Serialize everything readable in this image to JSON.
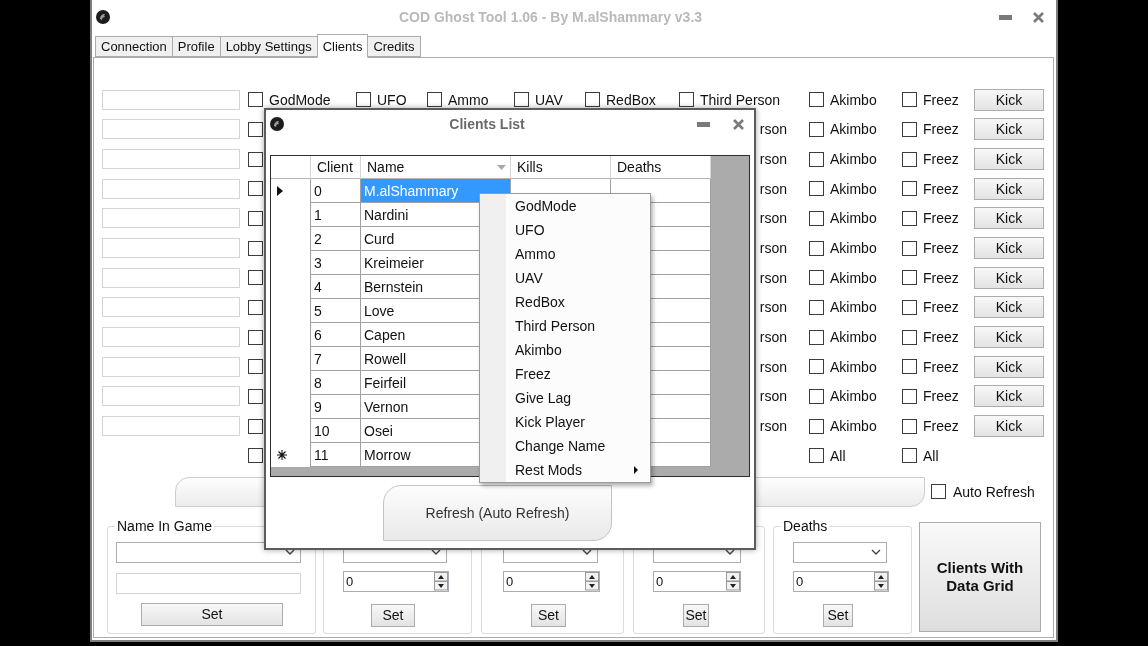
{
  "window": {
    "title": "COD Ghost Tool 1.06 - By M.alShammary v3.3"
  },
  "tabs": [
    {
      "label": "Connection",
      "selected": false
    },
    {
      "label": "Profile",
      "selected": false
    },
    {
      "label": "Lobby Settings",
      "selected": false
    },
    {
      "label": "Clients",
      "selected": true
    },
    {
      "label": "Credits",
      "selected": false
    }
  ],
  "client_rows": [
    {
      "kind": "client",
      "mods": [
        {
          "kind": "check",
          "label": "GodMode",
          "checked": false
        },
        {
          "kind": "check",
          "label": "UFO",
          "checked": false
        },
        {
          "kind": "check",
          "label": "Ammo",
          "checked": false
        },
        {
          "kind": "check",
          "label": "UAV",
          "checked": false
        },
        {
          "kind": "check",
          "label": "RedBox",
          "checked": false
        },
        {
          "kind": "check",
          "label": "Third Person",
          "checked": false
        },
        {
          "kind": "check",
          "label": "Akimbo",
          "checked": false
        },
        {
          "kind": "check",
          "label": "Freez",
          "checked": false
        }
      ],
      "button": "Kick"
    },
    {
      "kind": "client",
      "mods": [
        {
          "kind": "box",
          "checked": false
        },
        {
          "kind": "text",
          "label": "rson"
        },
        {
          "kind": "check",
          "label": "Akimbo",
          "checked": false
        },
        {
          "kind": "check",
          "label": "Freez",
          "checked": false
        }
      ],
      "button": "Kick"
    },
    {
      "kind": "client",
      "mods": [
        {
          "kind": "box",
          "checked": false
        },
        {
          "kind": "text",
          "label": "rson"
        },
        {
          "kind": "check",
          "label": "Akimbo",
          "checked": false
        },
        {
          "kind": "check",
          "label": "Freez",
          "checked": false
        }
      ],
      "button": "Kick"
    },
    {
      "kind": "client",
      "mods": [
        {
          "kind": "box",
          "checked": false
        },
        {
          "kind": "text",
          "label": "rson"
        },
        {
          "kind": "check",
          "label": "Akimbo",
          "checked": false
        },
        {
          "kind": "check",
          "label": "Freez",
          "checked": false
        }
      ],
      "button": "Kick"
    },
    {
      "kind": "client",
      "mods": [
        {
          "kind": "box",
          "checked": false
        },
        {
          "kind": "text",
          "label": "rson"
        },
        {
          "kind": "check",
          "label": "Akimbo",
          "checked": false
        },
        {
          "kind": "check",
          "label": "Freez",
          "checked": false
        }
      ],
      "button": "Kick"
    },
    {
      "kind": "client",
      "mods": [
        {
          "kind": "box",
          "checked": false
        },
        {
          "kind": "text",
          "label": "rson"
        },
        {
          "kind": "check",
          "label": "Akimbo",
          "checked": false
        },
        {
          "kind": "check",
          "label": "Freez",
          "checked": false
        }
      ],
      "button": "Kick"
    },
    {
      "kind": "client",
      "mods": [
        {
          "kind": "box",
          "checked": false
        },
        {
          "kind": "text",
          "label": "rson"
        },
        {
          "kind": "check",
          "label": "Akimbo",
          "checked": false
        },
        {
          "kind": "check",
          "label": "Freez",
          "checked": false
        }
      ],
      "button": "Kick"
    },
    {
      "kind": "client",
      "mods": [
        {
          "kind": "box",
          "checked": false
        },
        {
          "kind": "text",
          "label": "rson"
        },
        {
          "kind": "check",
          "label": "Akimbo",
          "checked": false
        },
        {
          "kind": "check",
          "label": "Freez",
          "checked": false
        }
      ],
      "button": "Kick"
    },
    {
      "kind": "client",
      "mods": [
        {
          "kind": "box",
          "checked": false
        },
        {
          "kind": "text",
          "label": "rson"
        },
        {
          "kind": "check",
          "label": "Akimbo",
          "checked": false
        },
        {
          "kind": "check",
          "label": "Freez",
          "checked": false
        }
      ],
      "button": "Kick"
    },
    {
      "kind": "client",
      "mods": [
        {
          "kind": "box",
          "checked": false
        },
        {
          "kind": "text",
          "label": "rson"
        },
        {
          "kind": "check",
          "label": "Akimbo",
          "checked": false
        },
        {
          "kind": "check",
          "label": "Freez",
          "checked": false
        }
      ],
      "button": "Kick"
    },
    {
      "kind": "client",
      "mods": [
        {
          "kind": "box",
          "checked": false
        },
        {
          "kind": "text",
          "label": "rson"
        },
        {
          "kind": "check",
          "label": "Akimbo",
          "checked": false
        },
        {
          "kind": "check",
          "label": "Freez",
          "checked": false
        }
      ],
      "button": "Kick"
    },
    {
      "kind": "client",
      "mods": [
        {
          "kind": "box",
          "checked": false
        },
        {
          "kind": "text",
          "label": "rson"
        },
        {
          "kind": "check",
          "label": "Akimbo",
          "checked": false
        },
        {
          "kind": "check",
          "label": "Freez",
          "checked": false
        }
      ],
      "button": "Kick"
    },
    {
      "kind": "all",
      "mods": [
        {
          "kind": "box",
          "checked": false
        },
        {
          "kind": "check",
          "label": "All",
          "checked": false
        },
        {
          "kind": "check",
          "label": "All",
          "checked": false
        }
      ]
    }
  ],
  "auto_refresh": {
    "label": "Auto Refresh",
    "checked": false
  },
  "groups": [
    {
      "kind": "text",
      "label": "Name In Game",
      "button": "Set"
    },
    {
      "kind": "numeric",
      "value": "0",
      "button": "Set"
    },
    {
      "kind": "numeric",
      "value": "0",
      "button": "Set"
    },
    {
      "kind": "numeric",
      "value": "0",
      "button": "Set"
    },
    {
      "kind": "numeric",
      "label": "Deaths",
      "value": "0",
      "button": "Set"
    }
  ],
  "data_grid_button": "Clients With Data Grid",
  "dialog": {
    "title": "Clients List",
    "columns": [
      "Client",
      "Name",
      "Kills",
      "Deaths"
    ],
    "rows": [
      {
        "client": "0",
        "name": "M.alShammary",
        "current": true,
        "selected": true,
        "new_row": false
      },
      {
        "client": "1",
        "name": "Nardini",
        "current": false,
        "selected": false,
        "new_row": false
      },
      {
        "client": "2",
        "name": "Curd",
        "current": false,
        "selected": false,
        "new_row": false
      },
      {
        "client": "3",
        "name": "Kreimeier",
        "current": false,
        "selected": false,
        "new_row": false
      },
      {
        "client": "4",
        "name": "Bernstein",
        "current": false,
        "selected": false,
        "new_row": false
      },
      {
        "client": "5",
        "name": "Love",
        "current": false,
        "selected": false,
        "new_row": false
      },
      {
        "client": "6",
        "name": "Capen",
        "current": false,
        "selected": false,
        "new_row": false
      },
      {
        "client": "7",
        "name": "Rowell",
        "current": false,
        "selected": false,
        "new_row": false
      },
      {
        "client": "8",
        "name": "Feirfeil",
        "current": false,
        "selected": false,
        "new_row": false
      },
      {
        "client": "9",
        "name": "Vernon",
        "current": false,
        "selected": false,
        "new_row": false
      },
      {
        "client": "10",
        "name": "Osei",
        "current": false,
        "selected": false,
        "new_row": false
      },
      {
        "client": "11",
        "name": "Morrow",
        "current": false,
        "selected": false,
        "new_row": true
      }
    ],
    "context_menu": [
      {
        "label": "GodMode",
        "submenu": false
      },
      {
        "label": "UFO",
        "submenu": false
      },
      {
        "label": "Ammo",
        "submenu": false
      },
      {
        "label": "UAV",
        "submenu": false
      },
      {
        "label": "RedBox",
        "submenu": false
      },
      {
        "label": "Third Person",
        "submenu": false
      },
      {
        "label": "Akimbo",
        "submenu": false
      },
      {
        "label": "Freez",
        "submenu": false
      },
      {
        "label": "Give Lag",
        "submenu": false
      },
      {
        "label": "Kick Player",
        "submenu": false
      },
      {
        "label": "Change Name",
        "submenu": false
      },
      {
        "label": "Rest Mods",
        "submenu": true
      }
    ],
    "button": "Refresh (Auto Refresh)"
  }
}
